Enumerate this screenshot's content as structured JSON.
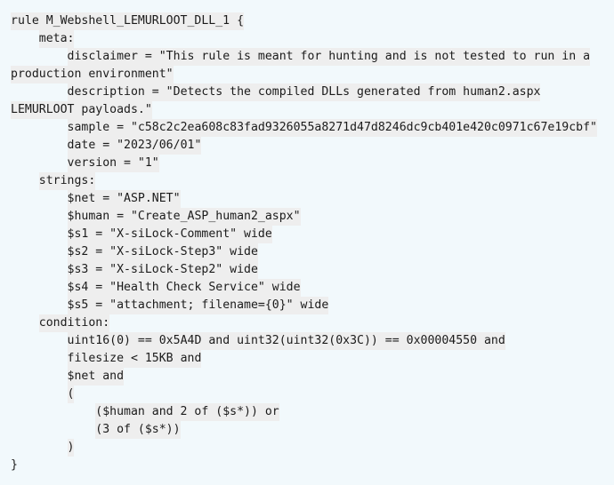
{
  "document": {
    "kind": "yara-rule",
    "rule_name": "M_Webshell_LEMURLOOT_DLL_1",
    "background_color": "#f2f9fc",
    "line_highlight_color": "#eeeeee",
    "text_color": "#1b1b1b"
  },
  "meta": {
    "disclaimer": "This rule is meant for hunting and is not tested to run in a production environment",
    "description": "Detects the compiled DLLs generated from human2.aspx LEMURLOOT payloads.",
    "sample": "c58c2c2ea608c83fad9326055a8271d47d8246dc9cb401e420c0971c67e19cbf",
    "date": "2023/06/01",
    "version": "1"
  },
  "strings": {
    "net": "ASP.NET",
    "human": "Create_ASP_human2_aspx",
    "s1": "X-siLock-Comment",
    "s2": "X-siLock-Step3",
    "s3": "X-siLock-Step2",
    "s4": "Health Check Service",
    "s5": "attachment; filename={0}"
  },
  "condition": {
    "magic_mz": "0x5A4D",
    "magic_pe": "0x00004550",
    "filesize_limit": "15KB"
  },
  "lines": [
    {
      "id": "line-rule-open",
      "indent": "",
      "text": "rule M_Webshell_LEMURLOOT_DLL_1 {"
    },
    {
      "id": "line-meta-label",
      "indent": "    ",
      "text": "meta:"
    },
    {
      "id": "line-meta-disclaimer",
      "indent": "        ",
      "text": "disclaimer = \"This rule is meant for hunting and is not tested to run in a"
    },
    {
      "id": "line-meta-disclaimer-cont",
      "indent": "",
      "text": "production environment\""
    },
    {
      "id": "line-meta-description",
      "indent": "        ",
      "text": "description = \"Detects the compiled DLLs generated from human2.aspx"
    },
    {
      "id": "line-meta-description-cont",
      "indent": "",
      "text": "LEMURLOOT payloads.\""
    },
    {
      "id": "line-meta-sample",
      "indent": "        ",
      "text": "sample = \"c58c2c2ea608c83fad9326055a8271d47d8246dc9cb401e420c0971c67e19cbf\""
    },
    {
      "id": "line-meta-date",
      "indent": "        ",
      "text": "date = \"2023/06/01\""
    },
    {
      "id": "line-meta-version",
      "indent": "        ",
      "text": "version = \"1\""
    },
    {
      "id": "line-strings-label",
      "indent": "    ",
      "text": "strings:"
    },
    {
      "id": "line-string-net",
      "indent": "        ",
      "text": "$net = \"ASP.NET\""
    },
    {
      "id": "line-string-human",
      "indent": "        ",
      "text": "$human = \"Create_ASP_human2_aspx\""
    },
    {
      "id": "line-string-s1",
      "indent": "        ",
      "text": "$s1 = \"X-siLock-Comment\" wide"
    },
    {
      "id": "line-string-s2",
      "indent": "        ",
      "text": "$s2 = \"X-siLock-Step3\" wide"
    },
    {
      "id": "line-string-s3",
      "indent": "        ",
      "text": "$s3 = \"X-siLock-Step2\" wide"
    },
    {
      "id": "line-string-s4",
      "indent": "        ",
      "text": "$s4 = \"Health Check Service\" wide"
    },
    {
      "id": "line-string-s5",
      "indent": "        ",
      "text": "$s5 = \"attachment; filename={0}\" wide"
    },
    {
      "id": "line-condition-label",
      "indent": "    ",
      "text": "condition:"
    },
    {
      "id": "line-condition-magic",
      "indent": "        ",
      "text": "uint16(0) == 0x5A4D and uint32(uint32(0x3C)) == 0x00004550 and"
    },
    {
      "id": "line-condition-filesize",
      "indent": "        ",
      "text": "filesize < 15KB and"
    },
    {
      "id": "line-condition-net",
      "indent": "        ",
      "text": "$net and"
    },
    {
      "id": "line-condition-paren-open",
      "indent": "        ",
      "text": "("
    },
    {
      "id": "line-condition-human-or",
      "indent": "            ",
      "text": "($human and 2 of ($s*)) or"
    },
    {
      "id": "line-condition-three-of",
      "indent": "            ",
      "text": "(3 of ($s*))"
    },
    {
      "id": "line-condition-paren-close",
      "indent": "        ",
      "text": ")"
    },
    {
      "id": "line-rule-close",
      "indent": "",
      "text": "}",
      "no_band": true
    }
  ]
}
